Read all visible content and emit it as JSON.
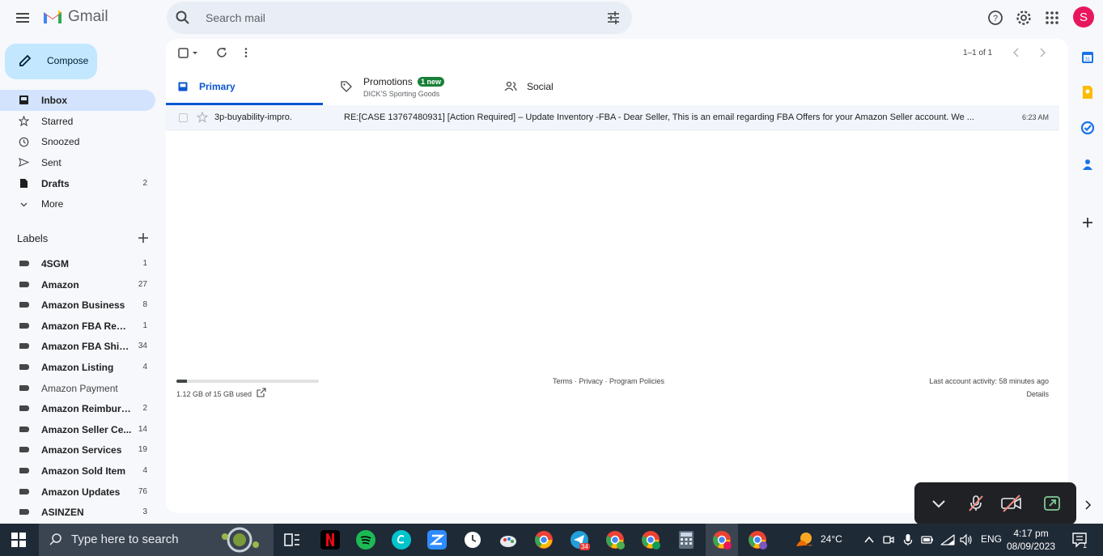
{
  "app": {
    "logo_text": "Gmail",
    "avatar_letter": "S"
  },
  "search": {
    "placeholder": "Search mail"
  },
  "compose": {
    "label": "Compose"
  },
  "nav": [
    {
      "label": "Inbox",
      "count": "",
      "icon": "inbox-icon"
    },
    {
      "label": "Starred",
      "count": "",
      "icon": "star-icon"
    },
    {
      "label": "Snoozed",
      "count": "",
      "icon": "clock-icon"
    },
    {
      "label": "Sent",
      "count": "",
      "icon": "send-icon"
    },
    {
      "label": "Drafts",
      "count": "2",
      "icon": "draft-icon"
    },
    {
      "label": "More",
      "count": "",
      "icon": "chevron-down-icon"
    }
  ],
  "labels_header": "Labels",
  "labels": [
    {
      "name": "4SGM",
      "count": "1"
    },
    {
      "name": "Amazon",
      "count": "27"
    },
    {
      "name": "Amazon Business",
      "count": "8"
    },
    {
      "name": "Amazon FBA Remo...",
      "count": "1"
    },
    {
      "name": "Amazon FBA Ship...",
      "count": "34"
    },
    {
      "name": "Amazon Listing",
      "count": "4"
    },
    {
      "name": "Amazon Payment",
      "count": ""
    },
    {
      "name": "Amazon Reimburse...",
      "count": "2"
    },
    {
      "name": "Amazon Seller Ce...",
      "count": "14"
    },
    {
      "name": "Amazon Services",
      "count": "19"
    },
    {
      "name": "Amazon Sold Item",
      "count": "4"
    },
    {
      "name": "Amazon Updates",
      "count": "76"
    },
    {
      "name": "ASINZEN",
      "count": "3"
    }
  ],
  "pagination": "1–1 of 1",
  "tabs": {
    "primary": "Primary",
    "promotions": "Promotions",
    "promotions_badge": "1 new",
    "promotions_sub": "DICK'S Sporting Goods",
    "social": "Social"
  },
  "email": {
    "sender": "3p-buyability-impro.",
    "subject": "RE:[CASE 13767480931] [Action Required] – Update Inventory -FBA - Dear Seller, This is an email regarding FBA Offers for your Amazon Seller account. We ...",
    "time": "6:23 AM"
  },
  "footer": {
    "storage_text": "1.12 GB of 15 GB used",
    "storage_fraction": 0.075,
    "links": "Terms · Privacy · Program Policies",
    "activity": "Last account activity: 58 minutes ago",
    "details": "Details"
  },
  "taskbar": {
    "search_placeholder": "Type here to search",
    "weather": "24°C",
    "language": "ENG",
    "time": "4:17 pm",
    "date": "08/09/2023",
    "telegram_badge": "34",
    "notification_count": "1"
  },
  "colors": {
    "accent": "#0b57d0",
    "compose_bg": "#c2e7ff",
    "active_nav": "#d3e3fd",
    "badge": "#188038"
  }
}
